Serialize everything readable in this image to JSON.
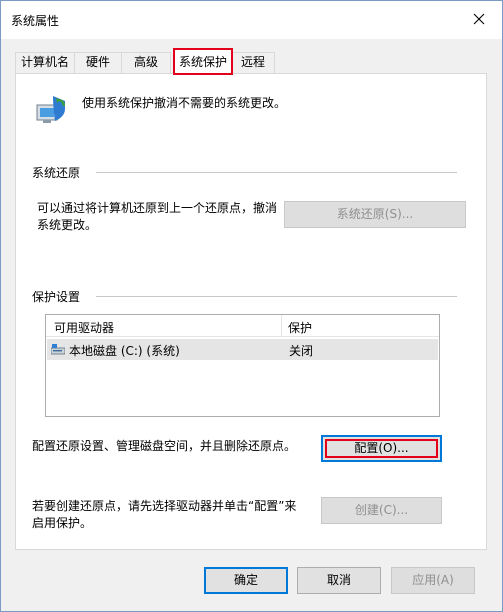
{
  "window": {
    "title": "系统属性"
  },
  "tabs": [
    {
      "label": "计算机名",
      "active": false
    },
    {
      "label": "硬件",
      "active": false
    },
    {
      "label": "高级",
      "active": false
    },
    {
      "label": "系统保护",
      "active": true
    },
    {
      "label": "远程",
      "active": false
    }
  ],
  "intro": {
    "text": "使用系统保护撤消不需要的系统更改。",
    "icon": "system-protection-icon"
  },
  "restore": {
    "group_label": "系统还原",
    "description_line1": "可以通过将计算机还原到上一个还原点，撤消",
    "description_line2": "系统更改。",
    "button_label": "系统还原(S)..."
  },
  "protection": {
    "group_label": "保护设置",
    "columns": [
      "可用驱动器",
      "保护"
    ],
    "rows": [
      {
        "drive": "本地磁盘 (C:) (系统)",
        "protection": "关闭",
        "icon": "drive-icon"
      }
    ],
    "configure_text": "配置还原设置、管理磁盘空间，并且删除还原点。",
    "configure_button": "配置(O)...",
    "create_text_line1": "若要创建还原点，请先选择驱动器并单击“配置”来",
    "create_text_line2": "启用保护。",
    "create_button": "创建(C)..."
  },
  "footer": {
    "ok": "确定",
    "cancel": "取消",
    "apply": "应用(A)"
  },
  "colors": {
    "highlight_box": "#e3001b",
    "focus_border": "#0078d7",
    "selected_row": "#e5e5e5"
  }
}
